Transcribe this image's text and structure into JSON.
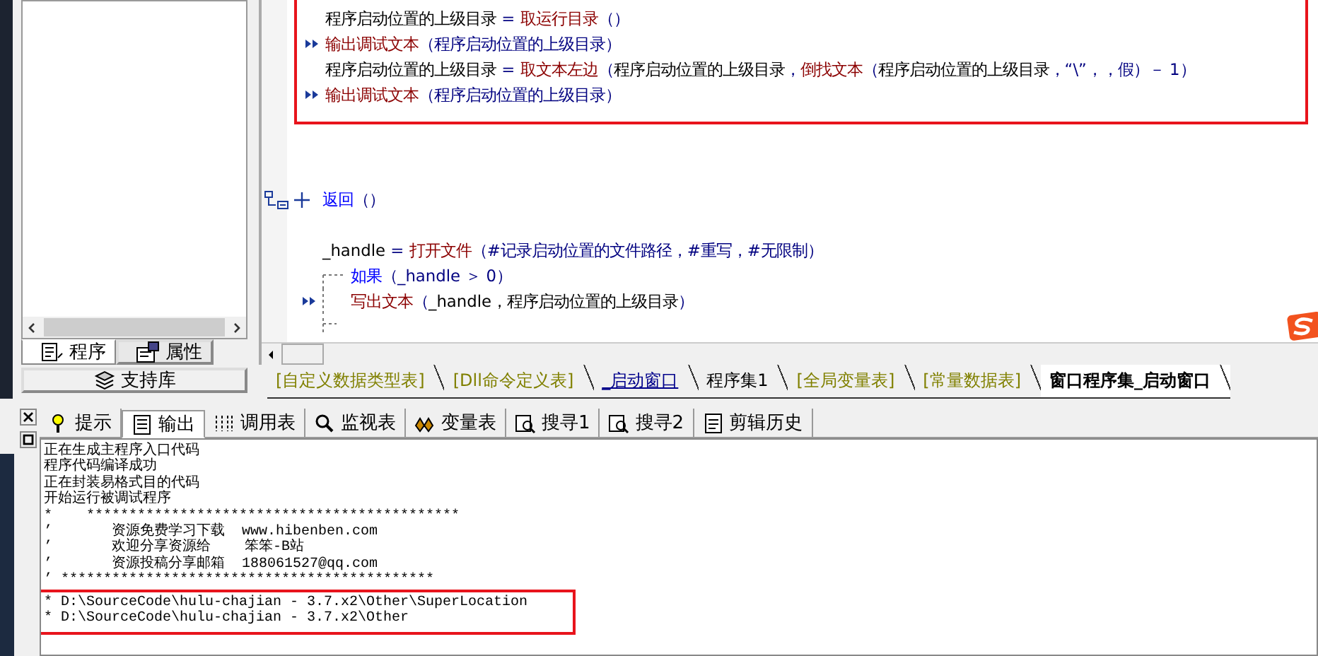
{
  "left_panel": {
    "tabs": [
      {
        "label": "程序",
        "selected": true
      },
      {
        "label": "属性",
        "selected": false
      }
    ],
    "support_button": "支持库"
  },
  "code": {
    "blocks": [
      {
        "kind": "plain",
        "highlighted": true,
        "lines": [
          {
            "arrow": false,
            "segments": [
              {
                "kind": "var",
                "text": "程序启动位置的上级目录 "
              },
              {
                "kind": "op",
                "text": "= "
              },
              {
                "kind": "cmd",
                "text": "取运行目录"
              },
              {
                "kind": "op",
                "text": "（）"
              }
            ]
          },
          {
            "arrow": true,
            "segments": [
              {
                "kind": "cmd",
                "text": "输出调试文本"
              },
              {
                "kind": "op",
                "text": "（程序启动位置的上级目录）"
              }
            ]
          },
          {
            "arrow": false,
            "segments": [
              {
                "kind": "var",
                "text": "程序启动位置的上级目录 "
              },
              {
                "kind": "op",
                "text": "= "
              },
              {
                "kind": "cmd",
                "text": "取文本左边"
              },
              {
                "kind": "op",
                "text": "（"
              },
              {
                "kind": "var",
                "text": "程序启动位置的上级目录"
              },
              {
                "kind": "op",
                "text": "，"
              },
              {
                "kind": "cmd",
                "text": "倒找文本"
              },
              {
                "kind": "op",
                "text": "（"
              },
              {
                "kind": "var",
                "text": "程序启动位置的上级目录"
              },
              {
                "kind": "op",
                "text": "，“\\”，，假）－ 1）"
              }
            ]
          },
          {
            "arrow": true,
            "segments": [
              {
                "kind": "cmd",
                "text": "输出调试文本"
              },
              {
                "kind": "op",
                "text": "（程序启动位置的上级目录）"
              }
            ]
          }
        ]
      },
      {
        "kind": "subroutine",
        "highlighted": false,
        "lines": [
          {
            "arrow": false,
            "segments": [
              {
                "kind": "keyword",
                "text": "返回"
              },
              {
                "kind": "op",
                "text": "（）"
              }
            ]
          }
        ]
      },
      {
        "kind": "plain",
        "highlighted": false,
        "lines": [
          {
            "arrow": false,
            "segments": [
              {
                "kind": "var",
                "text": "_handle "
              },
              {
                "kind": "op",
                "text": "= "
              },
              {
                "kind": "cmd",
                "text": "打开文件"
              },
              {
                "kind": "op",
                "text": "（#记录启动位置的文件路径，#重写，#无限制）"
              }
            ]
          }
        ]
      },
      {
        "kind": "flow",
        "highlighted": false,
        "lines": [
          {
            "arrow": false,
            "segments": [
              {
                "kind": "keyword",
                "text": "如果"
              },
              {
                "kind": "op",
                "text": "（_handle ＞ 0）"
              }
            ]
          },
          {
            "arrow": true,
            "segments": [
              {
                "kind": "cmd",
                "text": "写出文本"
              },
              {
                "kind": "op",
                "text": "（"
              },
              {
                "kind": "var",
                "text": "_handle，程序启动位置的上级目录"
              },
              {
                "kind": "op",
                "text": "）"
              }
            ]
          }
        ]
      }
    ]
  },
  "doc_tabs": [
    {
      "label": "[自定义数据类型表]",
      "kind": "table",
      "selected": false
    },
    {
      "label": "[Dll命令定义表]",
      "kind": "table",
      "selected": false
    },
    {
      "label": "_启动窗口",
      "kind": "form",
      "selected": false
    },
    {
      "label": "程序集1",
      "kind": "module",
      "selected": false
    },
    {
      "label": "[全局变量表]",
      "kind": "table",
      "selected": false
    },
    {
      "label": "[常量数据表]",
      "kind": "table",
      "selected": false
    },
    {
      "label": "窗口程序集_启动窗口",
      "kind": "module",
      "selected": true
    }
  ],
  "output_tabs": [
    {
      "label": "提示",
      "selected": false
    },
    {
      "label": "输出",
      "selected": true
    },
    {
      "label": "调用表",
      "selected": false
    },
    {
      "label": "监视表",
      "selected": false
    },
    {
      "label": "变量表",
      "selected": false
    },
    {
      "label": "搜寻1",
      "selected": false
    },
    {
      "label": "搜寻2",
      "selected": false
    },
    {
      "label": "剪辑历史",
      "selected": false
    }
  ],
  "output": {
    "blocks": [
      {
        "highlighted": false,
        "lines": [
          "正在生成主程序入口代码",
          "程序代码编译成功",
          "正在封装易格式目的代码",
          "开始运行被调试程序",
          "*    ********************************************",
          "’       资源免费学习下载  www.hibenben.com",
          "’       欢迎分享资源给    笨笨-B站",
          "’       资源投稿分享邮箱  188061527@qq.com",
          "’ ********************************************"
        ]
      },
      {
        "highlighted": true,
        "lines": [
          "* D:\\SourceCode\\hulu-chajian - 3.7.x2\\Other\\SuperLocation",
          "* D:\\SourceCode\\hulu-chajian - 3.7.x2\\Other"
        ]
      }
    ]
  }
}
